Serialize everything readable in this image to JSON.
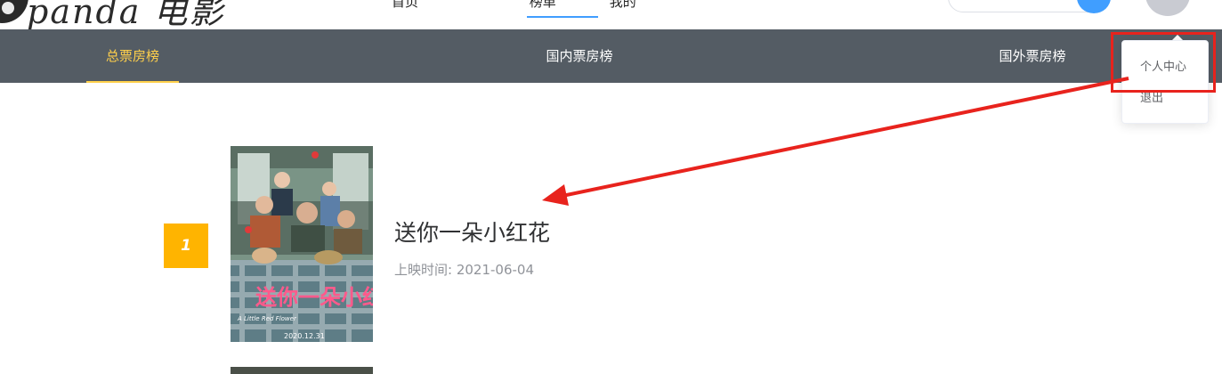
{
  "header": {
    "logo_text": "panda 电影",
    "nav_visible": "首页　　　　　　　　 榜单　　　　我的"
  },
  "subnav": {
    "tabs": [
      {
        "label": "总票房榜",
        "active": true
      },
      {
        "label": "国内票房榜",
        "active": false
      },
      {
        "label": "国外票房榜",
        "active": false
      }
    ]
  },
  "user_menu": {
    "items": [
      {
        "label": "个人中心"
      },
      {
        "label": "退出"
      }
    ]
  },
  "rank_list": [
    {
      "rank": "1",
      "title": "送你一朵小红花",
      "release_label": "上映时间:",
      "release_date": "2021-06-04",
      "poster": {
        "title_art": "送你一朵小红花",
        "subtitle": "A Little Red Flower",
        "date": "2020.12.31"
      }
    }
  ],
  "colors": {
    "subnav_bg": "#545c64",
    "subnav_active": "#ffd04b",
    "rank_badge": "#ffb400",
    "annotation_red": "#e8231d",
    "accent_blue": "#409eff"
  }
}
